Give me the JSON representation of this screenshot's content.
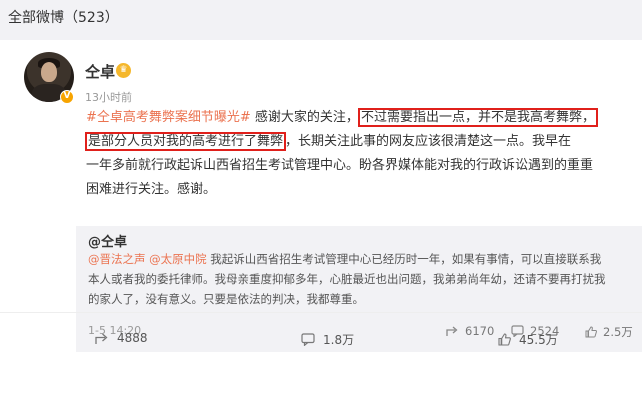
{
  "header": {
    "title": "全部微博（523）"
  },
  "post": {
    "author": "仝卓",
    "time": "13小时前",
    "hashtag": "#仝卓高考舞弊案细节曝光#",
    "line1_after_tag": " 感谢大家的关注，",
    "highlight1": "不过需要指出一点，并不是我高考舞弊，",
    "highlight2": "是部分人员对我的高考进行了舞弊",
    "line2_rest": "，长期关注此事的网友应该很清楚这一点。我早在",
    "line3": "一年多前就行政起诉山西省招生考试管理中心。盼各界媒体能对我的行政诉讼遇到的重重",
    "line4": "困难进行关注。感谢。"
  },
  "repost": {
    "author": "@仝卓",
    "mention1": "@晋法之声",
    "mention2": "@太原中院",
    "line1_rest": " 我起诉山西省招生考试管理中心已经历时一年，如果有事情，可以直接联系我",
    "line2": "本人或者我的委托律师。我母亲重度抑郁多年，心脏最近也出问题，我弟弟尚年幼，还请不要再打扰我",
    "line3": "的家人了，没有意义。只要是依法的判决，我都尊重。",
    "time": "1-5 14:20",
    "forwards": "6170",
    "comments": "2524",
    "likes": "2.5万"
  },
  "footer": {
    "forwards": "4888",
    "comments": "1.8万",
    "likes": "45.5万"
  },
  "colors": {
    "link": "#eb7350",
    "highlight_border": "#e0201b",
    "vip_badge": "#f7a400"
  },
  "icons": [
    "vip-badge-icon",
    "crown-badge-icon",
    "forward-icon",
    "comment-icon",
    "like-icon"
  ]
}
